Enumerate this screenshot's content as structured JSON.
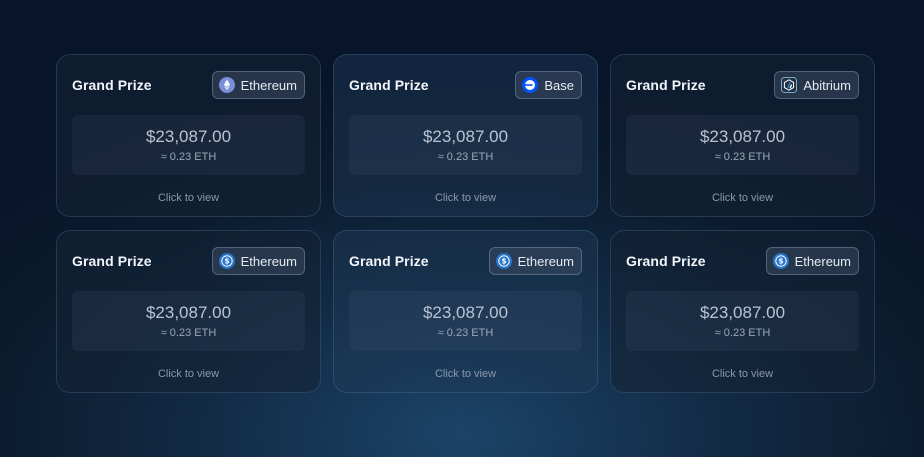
{
  "cards": [
    {
      "title": "Grand Prize",
      "chain": "Ethereum",
      "chain_icon": "ethereum-icon",
      "amount": "$23,087.00",
      "eth": "≈ 0.23 ETH",
      "cta": "Click to view"
    },
    {
      "title": "Grand Prize",
      "chain": "Base",
      "chain_icon": "base-icon",
      "amount": "$23,087.00",
      "eth": "≈ 0.23 ETH",
      "cta": "Click to view"
    },
    {
      "title": "Grand Prize",
      "chain": "Abitrium",
      "chain_icon": "arbitrum-icon",
      "amount": "$23,087.00",
      "eth": "≈ 0.23 ETH",
      "cta": "Click to view"
    },
    {
      "title": "Grand Prize",
      "chain": "Ethereum",
      "chain_icon": "usdc-icon",
      "amount": "$23,087.00",
      "eth": "≈ 0.23 ETH",
      "cta": "Click to view"
    },
    {
      "title": "Grand Prize",
      "chain": "Ethereum",
      "chain_icon": "usdc-icon",
      "amount": "$23,087.00",
      "eth": "≈ 0.23 ETH",
      "cta": "Click to view"
    },
    {
      "title": "Grand Prize",
      "chain": "Ethereum",
      "chain_icon": "usdc-icon",
      "amount": "$23,087.00",
      "eth": "≈ 0.23 ETH",
      "cta": "Click to view"
    }
  ],
  "colors": {
    "ethereum": "#7b8fd6",
    "base": "#0052ff",
    "arbitrum": "#28a0f0",
    "usdc": "#2775ca"
  }
}
